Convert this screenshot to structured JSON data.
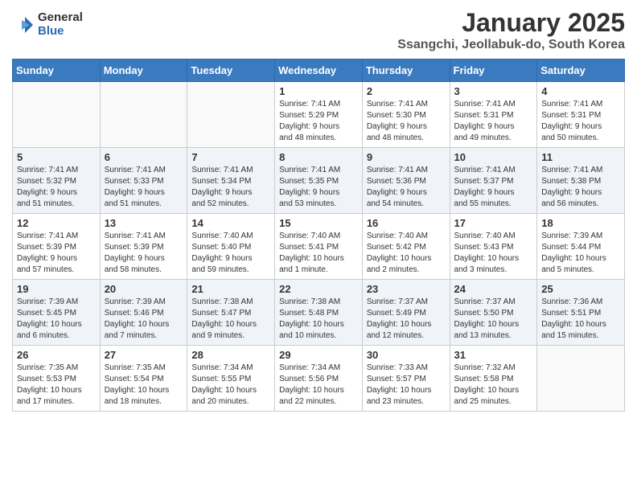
{
  "header": {
    "logo_line1": "General",
    "logo_line2": "Blue",
    "month_title": "January 2025",
    "location": "Ssangchi, Jeollabuk-do, South Korea"
  },
  "weekdays": [
    "Sunday",
    "Monday",
    "Tuesday",
    "Wednesday",
    "Thursday",
    "Friday",
    "Saturday"
  ],
  "weeks": [
    [
      {
        "day": "",
        "info": ""
      },
      {
        "day": "",
        "info": ""
      },
      {
        "day": "",
        "info": ""
      },
      {
        "day": "1",
        "info": "Sunrise: 7:41 AM\nSunset: 5:29 PM\nDaylight: 9 hours\nand 48 minutes."
      },
      {
        "day": "2",
        "info": "Sunrise: 7:41 AM\nSunset: 5:30 PM\nDaylight: 9 hours\nand 48 minutes."
      },
      {
        "day": "3",
        "info": "Sunrise: 7:41 AM\nSunset: 5:31 PM\nDaylight: 9 hours\nand 49 minutes."
      },
      {
        "day": "4",
        "info": "Sunrise: 7:41 AM\nSunset: 5:31 PM\nDaylight: 9 hours\nand 50 minutes."
      }
    ],
    [
      {
        "day": "5",
        "info": "Sunrise: 7:41 AM\nSunset: 5:32 PM\nDaylight: 9 hours\nand 51 minutes."
      },
      {
        "day": "6",
        "info": "Sunrise: 7:41 AM\nSunset: 5:33 PM\nDaylight: 9 hours\nand 51 minutes."
      },
      {
        "day": "7",
        "info": "Sunrise: 7:41 AM\nSunset: 5:34 PM\nDaylight: 9 hours\nand 52 minutes."
      },
      {
        "day": "8",
        "info": "Sunrise: 7:41 AM\nSunset: 5:35 PM\nDaylight: 9 hours\nand 53 minutes."
      },
      {
        "day": "9",
        "info": "Sunrise: 7:41 AM\nSunset: 5:36 PM\nDaylight: 9 hours\nand 54 minutes."
      },
      {
        "day": "10",
        "info": "Sunrise: 7:41 AM\nSunset: 5:37 PM\nDaylight: 9 hours\nand 55 minutes."
      },
      {
        "day": "11",
        "info": "Sunrise: 7:41 AM\nSunset: 5:38 PM\nDaylight: 9 hours\nand 56 minutes."
      }
    ],
    [
      {
        "day": "12",
        "info": "Sunrise: 7:41 AM\nSunset: 5:39 PM\nDaylight: 9 hours\nand 57 minutes."
      },
      {
        "day": "13",
        "info": "Sunrise: 7:41 AM\nSunset: 5:39 PM\nDaylight: 9 hours\nand 58 minutes."
      },
      {
        "day": "14",
        "info": "Sunrise: 7:40 AM\nSunset: 5:40 PM\nDaylight: 9 hours\nand 59 minutes."
      },
      {
        "day": "15",
        "info": "Sunrise: 7:40 AM\nSunset: 5:41 PM\nDaylight: 10 hours\nand 1 minute."
      },
      {
        "day": "16",
        "info": "Sunrise: 7:40 AM\nSunset: 5:42 PM\nDaylight: 10 hours\nand 2 minutes."
      },
      {
        "day": "17",
        "info": "Sunrise: 7:40 AM\nSunset: 5:43 PM\nDaylight: 10 hours\nand 3 minutes."
      },
      {
        "day": "18",
        "info": "Sunrise: 7:39 AM\nSunset: 5:44 PM\nDaylight: 10 hours\nand 5 minutes."
      }
    ],
    [
      {
        "day": "19",
        "info": "Sunrise: 7:39 AM\nSunset: 5:45 PM\nDaylight: 10 hours\nand 6 minutes."
      },
      {
        "day": "20",
        "info": "Sunrise: 7:39 AM\nSunset: 5:46 PM\nDaylight: 10 hours\nand 7 minutes."
      },
      {
        "day": "21",
        "info": "Sunrise: 7:38 AM\nSunset: 5:47 PM\nDaylight: 10 hours\nand 9 minutes."
      },
      {
        "day": "22",
        "info": "Sunrise: 7:38 AM\nSunset: 5:48 PM\nDaylight: 10 hours\nand 10 minutes."
      },
      {
        "day": "23",
        "info": "Sunrise: 7:37 AM\nSunset: 5:49 PM\nDaylight: 10 hours\nand 12 minutes."
      },
      {
        "day": "24",
        "info": "Sunrise: 7:37 AM\nSunset: 5:50 PM\nDaylight: 10 hours\nand 13 minutes."
      },
      {
        "day": "25",
        "info": "Sunrise: 7:36 AM\nSunset: 5:51 PM\nDaylight: 10 hours\nand 15 minutes."
      }
    ],
    [
      {
        "day": "26",
        "info": "Sunrise: 7:35 AM\nSunset: 5:53 PM\nDaylight: 10 hours\nand 17 minutes."
      },
      {
        "day": "27",
        "info": "Sunrise: 7:35 AM\nSunset: 5:54 PM\nDaylight: 10 hours\nand 18 minutes."
      },
      {
        "day": "28",
        "info": "Sunrise: 7:34 AM\nSunset: 5:55 PM\nDaylight: 10 hours\nand 20 minutes."
      },
      {
        "day": "29",
        "info": "Sunrise: 7:34 AM\nSunset: 5:56 PM\nDaylight: 10 hours\nand 22 minutes."
      },
      {
        "day": "30",
        "info": "Sunrise: 7:33 AM\nSunset: 5:57 PM\nDaylight: 10 hours\nand 23 minutes."
      },
      {
        "day": "31",
        "info": "Sunrise: 7:32 AM\nSunset: 5:58 PM\nDaylight: 10 hours\nand 25 minutes."
      },
      {
        "day": "",
        "info": ""
      }
    ]
  ]
}
